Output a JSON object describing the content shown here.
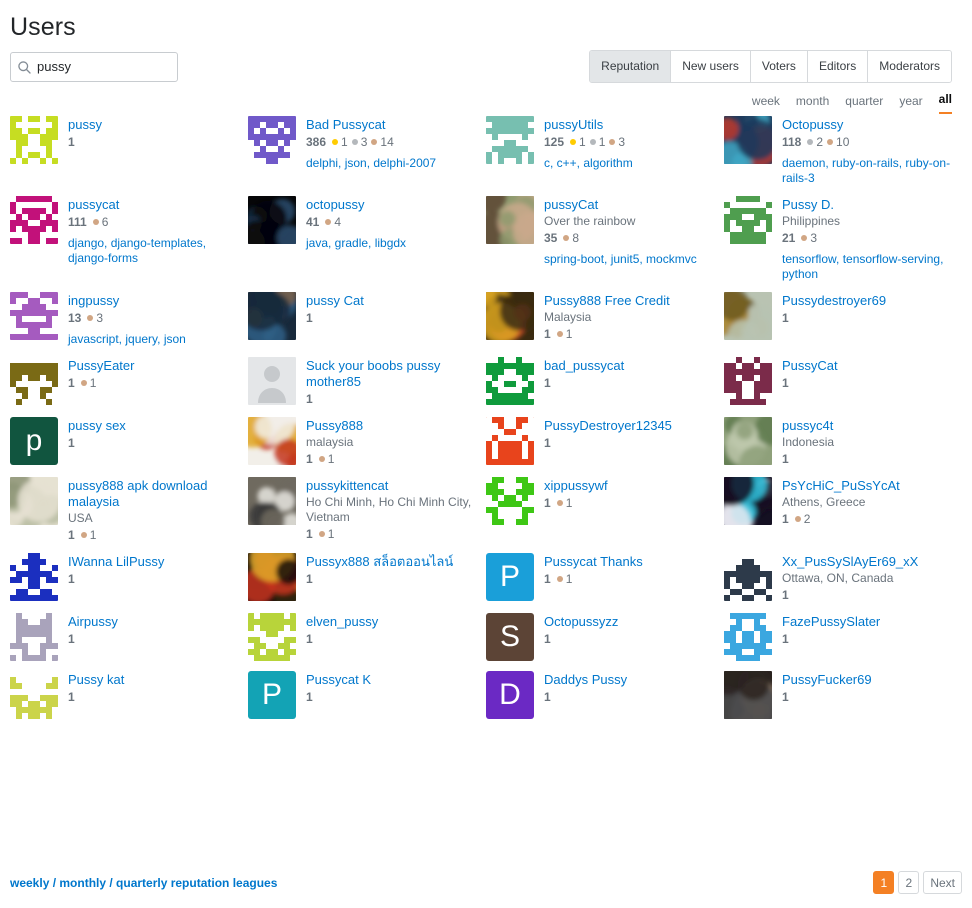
{
  "header": {
    "title": "Users",
    "search": {
      "value": "pussy",
      "placeholder": "",
      "icon": "search-icon"
    }
  },
  "tabs": [
    {
      "label": "Reputation",
      "selected": true
    },
    {
      "label": "New users",
      "selected": false
    },
    {
      "label": "Voters",
      "selected": false
    },
    {
      "label": "Editors",
      "selected": false
    },
    {
      "label": "Moderators",
      "selected": false
    }
  ],
  "time_filters": [
    {
      "label": "week",
      "selected": false
    },
    {
      "label": "month",
      "selected": false
    },
    {
      "label": "quarter",
      "selected": false
    },
    {
      "label": "year",
      "selected": false
    },
    {
      "label": "all",
      "selected": true
    }
  ],
  "colors": {
    "accent": "#f48024",
    "link": "#0077cc",
    "muted": "#6a737c",
    "gold": "#ffcc01",
    "silver": "#b4b8bc",
    "bronze": "#d1a684"
  },
  "users": [
    {
      "name": "pussy",
      "location": "",
      "rep": "1",
      "gold": "",
      "silver": "",
      "bronze": "",
      "tags": "",
      "avatar": {
        "type": "identicon",
        "bg": "#ffffff",
        "fg": "#c6dd22",
        "seed": 11
      }
    },
    {
      "name": "Bad Pussycat",
      "location": "",
      "rep": "386",
      "gold": "1",
      "silver": "3",
      "bronze": "14",
      "tags": "delphi, json, delphi-2007",
      "avatar": {
        "type": "identicon",
        "bg": "#ffffff",
        "fg": "#7059c9",
        "seed": 27
      }
    },
    {
      "name": "pussyUtils",
      "location": "",
      "rep": "125",
      "gold": "1",
      "silver": "1",
      "bronze": "3",
      "tags": "c, c++, algorithm",
      "avatar": {
        "type": "identicon",
        "bg": "#ffffff",
        "fg": "#77bfb0",
        "seed": 41
      }
    },
    {
      "name": "Octopussy",
      "location": "",
      "rep": "118",
      "gold": "",
      "silver": "2",
      "bronze": "10",
      "tags": "daemon, ruby-on-rails, ruby-on-rails-3",
      "avatar": {
        "type": "photo",
        "c1": "#1d3a5c",
        "c2": "#3fa7c4",
        "c3": "#c0392b"
      }
    },
    {
      "name": "pussycat",
      "location": "",
      "rep": "111",
      "gold": "",
      "silver": "",
      "bronze": "6",
      "tags": "django, django-templates, django-forms",
      "avatar": {
        "type": "identicon",
        "bg": "#ffffff",
        "fg": "#c2117a",
        "seed": 53
      }
    },
    {
      "name": "octopussy",
      "location": "",
      "rep": "41",
      "gold": "",
      "silver": "",
      "bronze": "4",
      "tags": "java, gradle, libgdx",
      "avatar": {
        "type": "photo",
        "c1": "#060608",
        "c2": "#1b3550",
        "c3": "#2b4e6e"
      }
    },
    {
      "name": "pussyCat",
      "location": "Over the rainbow",
      "rep": "35",
      "gold": "",
      "silver": "",
      "bronze": "8",
      "tags": "spring-boot, junit5, mockmvc",
      "avatar": {
        "type": "photo",
        "c1": "#8f9b6f",
        "c2": "#caa98c",
        "c3": "#5c4434"
      }
    },
    {
      "name": "Pussy D.",
      "location": "Philippines",
      "rep": "21",
      "gold": "",
      "silver": "",
      "bronze": "3",
      "tags": "tensorflow, tensorflow-serving, python",
      "avatar": {
        "type": "identicon",
        "bg": "#ffffff",
        "fg": "#4f9e4f",
        "seed": 67
      }
    },
    {
      "name": "ingpussy",
      "location": "",
      "rep": "13",
      "gold": "",
      "silver": "",
      "bronze": "3",
      "tags": "javascript, jquery, json",
      "avatar": {
        "type": "identicon",
        "bg": "#ffffff",
        "fg": "#a55bbf",
        "seed": 73
      }
    },
    {
      "name": "pussy Cat",
      "location": "",
      "rep": "1",
      "gold": "",
      "silver": "",
      "bronze": "",
      "tags": "",
      "avatar": {
        "type": "photo",
        "c1": "#18293b",
        "c2": "#2e5f86",
        "c3": "#7b6048"
      }
    },
    {
      "name": "Pussy888 Free Credit",
      "location": "Malaysia",
      "rep": "1",
      "gold": "",
      "silver": "",
      "bronze": "1",
      "tags": "",
      "avatar": {
        "type": "photo",
        "c1": "#3a2a10",
        "c2": "#d9a521",
        "c3": "#e8542b"
      }
    },
    {
      "name": "Pussydestroyer69",
      "location": "",
      "rep": "1",
      "gold": "",
      "silver": "",
      "bronze": "",
      "tags": "",
      "avatar": {
        "type": "photo",
        "c1": "#b9c3b2",
        "c2": "#a8832c",
        "c3": "#6d5a22"
      }
    },
    {
      "name": "PussyEater",
      "location": "",
      "rep": "1",
      "gold": "",
      "silver": "",
      "bronze": "1",
      "tags": "",
      "avatar": {
        "type": "identicon",
        "bg": "#ffffff",
        "fg": "#7a6a15",
        "seed": 89
      }
    },
    {
      "name": "Suck your boobs pussy mother85",
      "location": "",
      "rep": "1",
      "gold": "",
      "silver": "",
      "bronze": "",
      "tags": "",
      "avatar": {
        "type": "placeholder",
        "bg": "#e4e6e8",
        "fg": "#c6c9cc"
      }
    },
    {
      "name": "bad_pussycat",
      "location": "",
      "rep": "1",
      "gold": "",
      "silver": "",
      "bronze": "",
      "tags": "",
      "avatar": {
        "type": "identicon",
        "bg": "#ffffff",
        "fg": "#0f9b3c",
        "seed": 97
      }
    },
    {
      "name": "PussyCat",
      "location": "",
      "rep": "1",
      "gold": "",
      "silver": "",
      "bronze": "",
      "tags": "",
      "avatar": {
        "type": "identicon",
        "bg": "#ffffff",
        "fg": "#7b2b4a",
        "seed": 103
      }
    },
    {
      "name": "pussy sex",
      "location": "",
      "rep": "1",
      "gold": "",
      "silver": "",
      "bronze": "",
      "tags": "",
      "avatar": {
        "type": "letter",
        "letter": "p",
        "bg": "#11553f"
      }
    },
    {
      "name": "Pussy888",
      "location": "malaysia",
      "rep": "1",
      "gold": "",
      "silver": "",
      "bronze": "1",
      "tags": "",
      "avatar": {
        "type": "photo",
        "c1": "#f2efe9",
        "c2": "#c4371d",
        "c3": "#e0a41d"
      }
    },
    {
      "name": "PussyDestroyer12345",
      "location": "",
      "rep": "1",
      "gold": "",
      "silver": "",
      "bronze": "",
      "tags": "",
      "avatar": {
        "type": "identicon",
        "bg": "#e8441c",
        "fg": "#ffffff",
        "seed": 109
      }
    },
    {
      "name": "pussyc4t",
      "location": "Indonesia",
      "rep": "1",
      "gold": "",
      "silver": "",
      "bronze": "",
      "tags": "",
      "avatar": {
        "type": "photo",
        "c1": "#8ea07a",
        "c2": "#5e7a4c",
        "c3": "#bfc9ae"
      }
    },
    {
      "name": "pussy888 apk download malaysia",
      "location": "USA",
      "rep": "1",
      "gold": "",
      "silver": "",
      "bronze": "1",
      "tags": "",
      "avatar": {
        "type": "photo",
        "c1": "#e6e2d2",
        "c2": "#b6bba0",
        "c3": "#8d9476"
      }
    },
    {
      "name": "pussykittencat",
      "location": "Ho Chi Minh, Ho Chi Minh City, Vietnam",
      "rep": "1",
      "gold": "",
      "silver": "",
      "bronze": "1",
      "tags": "",
      "avatar": {
        "type": "photo",
        "c1": "#6f6a5f",
        "c2": "#e8e6e1",
        "c3": "#3a3a3a"
      }
    },
    {
      "name": "xippussywf",
      "location": "",
      "rep": "1",
      "gold": "",
      "silver": "",
      "bronze": "1",
      "tags": "",
      "avatar": {
        "type": "identicon",
        "bg": "#ffffff",
        "fg": "#3ec715",
        "seed": 113
      }
    },
    {
      "name": "PsYcHiC_PuSsYcAt",
      "location": "Athens, Greece",
      "rep": "1",
      "gold": "",
      "silver": "",
      "bronze": "2",
      "tags": "",
      "avatar": {
        "type": "photo",
        "c1": "#141022",
        "c2": "#e8e8f0",
        "c3": "#30c6e0"
      }
    },
    {
      "name": "IWanna LilPussy",
      "location": "",
      "rep": "1",
      "gold": "",
      "silver": "",
      "bronze": "",
      "tags": "",
      "avatar": {
        "type": "identicon",
        "bg": "#ffffff",
        "fg": "#1b2fbf",
        "seed": 127
      }
    },
    {
      "name": "Pussyx888 สล็อตออนไลน์",
      "location": "",
      "rep": "1",
      "gold": "",
      "silver": "",
      "bronze": "",
      "tags": "",
      "avatar": {
        "type": "photo",
        "c1": "#140d0a",
        "c2": "#c8341f",
        "c3": "#e0a928"
      }
    },
    {
      "name": "Pussycat Thanks",
      "location": "",
      "rep": "1",
      "gold": "",
      "silver": "",
      "bronze": "1",
      "tags": "",
      "avatar": {
        "type": "letter",
        "letter": "P",
        "bg": "#1a9fd9"
      }
    },
    {
      "name": "Xx_PusSySlAyEr69_xX",
      "location": "Ottawa, ON, Canada",
      "rep": "1",
      "gold": "",
      "silver": "",
      "bronze": "",
      "tags": "",
      "avatar": {
        "type": "identicon",
        "bg": "#ffffff",
        "fg": "#2d3a4a",
        "seed": 131
      }
    },
    {
      "name": "Airpussy",
      "location": "",
      "rep": "1",
      "gold": "",
      "silver": "",
      "bronze": "",
      "tags": "",
      "avatar": {
        "type": "identicon",
        "bg": "#ffffff",
        "fg": "#a9a3bb",
        "seed": 137
      }
    },
    {
      "name": "elven_pussy",
      "location": "",
      "rep": "1",
      "gold": "",
      "silver": "",
      "bronze": "",
      "tags": "",
      "avatar": {
        "type": "identicon",
        "bg": "#ffffff",
        "fg": "#b8d43a",
        "seed": 139
      }
    },
    {
      "name": "Octopussyzz",
      "location": "",
      "rep": "1",
      "gold": "",
      "silver": "",
      "bronze": "",
      "tags": "",
      "avatar": {
        "type": "letter",
        "letter": "S",
        "bg": "#5c4436"
      }
    },
    {
      "name": "FazePussySlater",
      "location": "",
      "rep": "1",
      "gold": "",
      "silver": "",
      "bronze": "",
      "tags": "",
      "avatar": {
        "type": "identicon",
        "bg": "#ffffff",
        "fg": "#3ba7e0",
        "seed": 149
      }
    },
    {
      "name": "Pussy kat",
      "location": "",
      "rep": "1",
      "gold": "",
      "silver": "",
      "bronze": "",
      "tags": "",
      "avatar": {
        "type": "identicon",
        "bg": "#ffffff",
        "fg": "#cbd44a",
        "seed": 151
      }
    },
    {
      "name": "Pussycat K",
      "location": "",
      "rep": "1",
      "gold": "",
      "silver": "",
      "bronze": "",
      "tags": "",
      "avatar": {
        "type": "letter",
        "letter": "P",
        "bg": "#13a3b5"
      }
    },
    {
      "name": "Daddys Pussy",
      "location": "",
      "rep": "1",
      "gold": "",
      "silver": "",
      "bronze": "",
      "tags": "",
      "avatar": {
        "type": "letter",
        "letter": "D",
        "bg": "#6b29c4"
      }
    },
    {
      "name": "PussyFucker69",
      "location": "",
      "rep": "1",
      "gold": "",
      "silver": "",
      "bronze": "",
      "tags": "",
      "avatar": {
        "type": "photo",
        "c1": "#2a2320",
        "c2": "#8c7a68",
        "c3": "#4a4a4c"
      }
    }
  ],
  "footer": {
    "leagues_link": "weekly / monthly / quarterly reputation leagues",
    "pagination": [
      {
        "label": "1",
        "current": true
      },
      {
        "label": "2",
        "current": false
      },
      {
        "label": "Next",
        "current": false
      }
    ]
  }
}
